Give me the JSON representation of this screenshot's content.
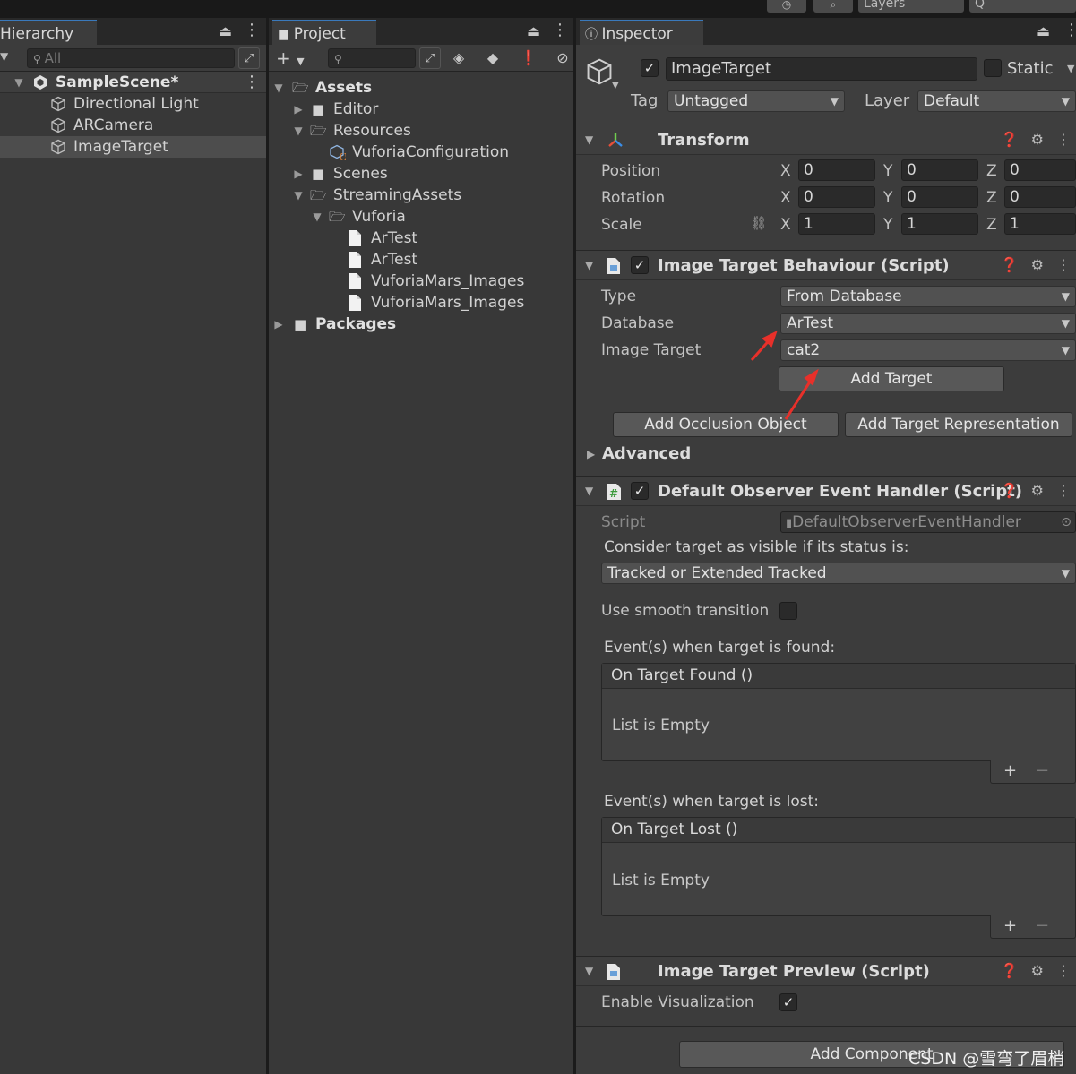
{
  "hierarchy": {
    "tab": "Hierarchy",
    "search_placeholder": "All",
    "scene": "SampleScene*",
    "items": [
      "Directional Light",
      "ARCamera",
      "ImageTarget"
    ]
  },
  "project": {
    "tab": "Project",
    "tree": {
      "assets": "Assets",
      "editor": "Editor",
      "resources": "Resources",
      "vuforia_configuration": "VuforiaConfiguration",
      "scenes": "Scenes",
      "streaming_assets": "StreamingAssets",
      "vuforia": "Vuforia",
      "files": [
        "ArTest",
        "ArTest",
        "VuforiaMars_Images",
        "VuforiaMars_Images"
      ],
      "packages": "Packages"
    }
  },
  "topbar": {
    "layers": "Layers",
    "layout": "Q"
  },
  "inspector": {
    "tab": "Inspector",
    "object_name": "ImageTarget",
    "static_label": "Static",
    "tag_label": "Tag",
    "tag_value": "Untagged",
    "layer_label": "Layer",
    "layer_value": "Default",
    "transform": {
      "title": "Transform",
      "position_label": "Position",
      "rotation_label": "Rotation",
      "scale_label": "Scale",
      "axis": [
        "X",
        "Y",
        "Z"
      ],
      "position": [
        "0",
        "0",
        "0"
      ],
      "rotation": [
        "0",
        "0",
        "0"
      ],
      "scale": [
        "1",
        "1",
        "1"
      ]
    },
    "itb": {
      "title": "Image Target Behaviour (Script)",
      "type_label": "Type",
      "type_value": "From Database",
      "database_label": "Database",
      "database_value": "ArTest",
      "image_target_label": "Image Target",
      "image_target_value": "cat2",
      "add_target": "Add Target",
      "add_occlusion": "Add Occlusion Object",
      "add_representation": "Add Target Representation",
      "advanced": "Advanced"
    },
    "doeh": {
      "title": "Default Observer Event Handler (Script)",
      "script_label": "Script",
      "script_value": "DefaultObserverEventHandler",
      "consider_label": "Consider target as visible if its status is:",
      "status_value": "Tracked or Extended Tracked",
      "smooth_label": "Use smooth transition o",
      "found_label": "Event(s) when target is found:",
      "found_event": "On Target Found ()",
      "found_empty": "List is Empty",
      "lost_label": "Event(s) when target is lost:",
      "lost_event": "On Target Lost ()",
      "lost_empty": "List is Empty",
      "plus": "+",
      "minus": "−"
    },
    "preview": {
      "title": "Image Target Preview (Script)",
      "enable_label": "Enable Visualization"
    },
    "add_component": "Add Component"
  },
  "watermark": "CSDN @雪弯了眉梢",
  "colors": {
    "annotation_arrow": "#e8302a",
    "tab_accent": "#3a79bb",
    "panel_bg": "#383838"
  }
}
